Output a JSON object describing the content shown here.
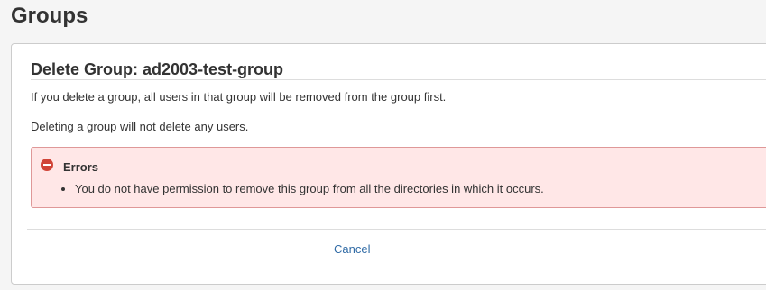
{
  "page": {
    "title": "Groups"
  },
  "dialog": {
    "title": "Delete Group: ad2003-test-group",
    "description_1": "If you delete a group, all users in that group will be removed from the group first.",
    "description_2": "Deleting a group will not delete any users."
  },
  "errors": {
    "title": "Errors",
    "items": [
      "You do not have permission to remove this group from all the directories in which it occurs."
    ]
  },
  "actions": {
    "cancel_label": "Cancel"
  },
  "colors": {
    "error_background": "#ffe7e7",
    "error_border": "#df9898",
    "error_icon": "#d04437",
    "link": "#326ca6"
  }
}
